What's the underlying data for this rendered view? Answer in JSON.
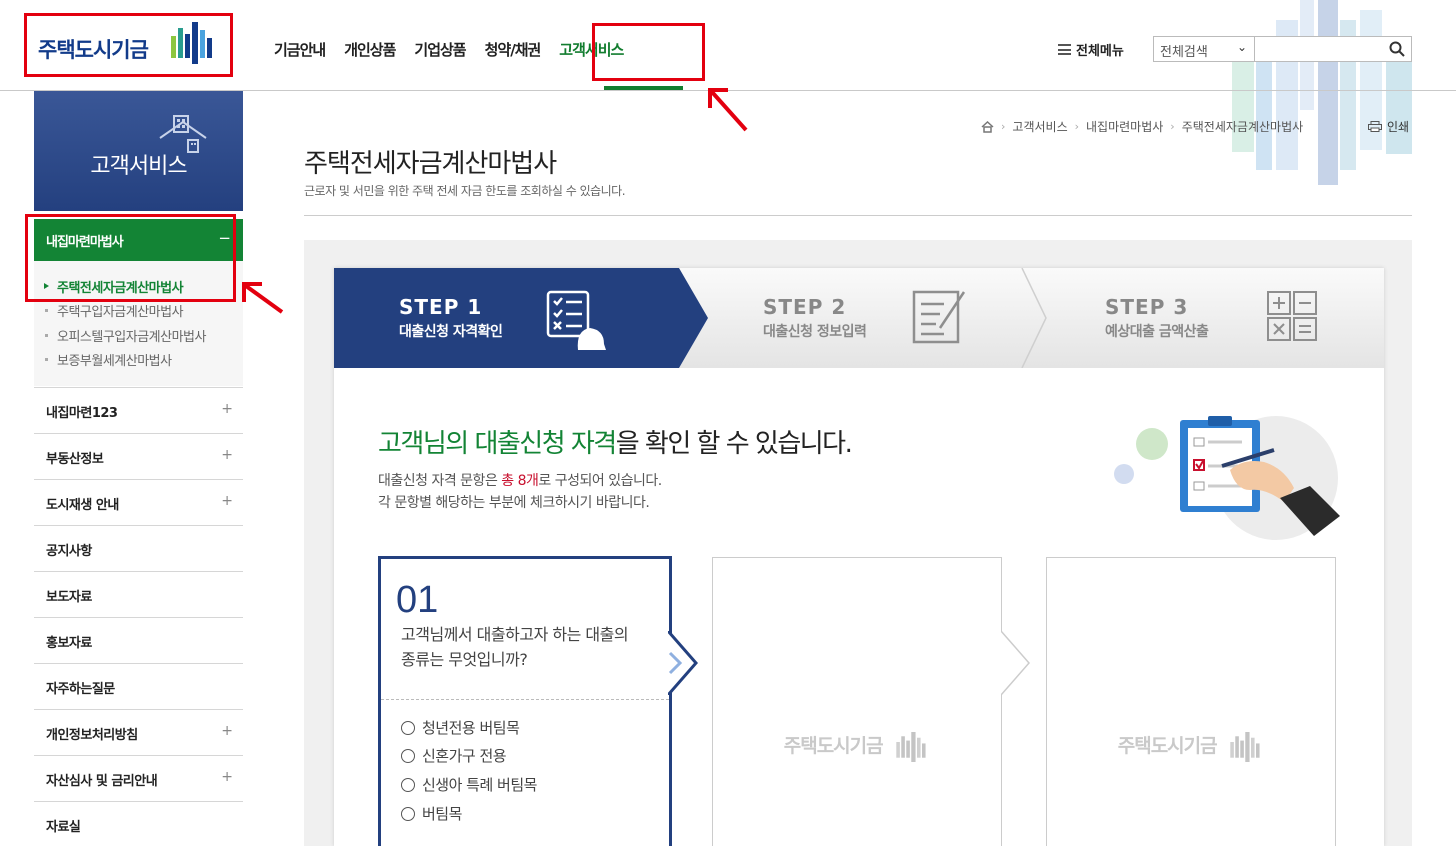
{
  "header": {
    "logo_text": "주택도시기금",
    "nav": [
      "기금안내",
      "개인상품",
      "기업상품",
      "청약/채권",
      "고객서비스"
    ],
    "active_nav": "고객서비스",
    "all_menu_label": "전체메뉴",
    "search_scope": "전체검색",
    "search_placeholder": ""
  },
  "sidebar": {
    "title": "고객서비스",
    "current_section": "내집마련마법사",
    "current_toggle": "−",
    "sub_items": [
      "주택전세자금계산마법사",
      "주택구입자금계산마법사",
      "오피스텔구입자금계산마법사",
      "보증부월세계산마법사"
    ],
    "menu": [
      {
        "label": "내집마련123",
        "toggle": "+"
      },
      {
        "label": "부동산정보",
        "toggle": "+"
      },
      {
        "label": "도시재생 안내",
        "toggle": "+"
      },
      {
        "label": "공지사항",
        "toggle": ""
      },
      {
        "label": "보도자료",
        "toggle": ""
      },
      {
        "label": "홍보자료",
        "toggle": ""
      },
      {
        "label": "자주하는질문",
        "toggle": ""
      },
      {
        "label": "개인정보처리방침",
        "toggle": "+"
      },
      {
        "label": "자산심사 및 금리안내",
        "toggle": "+"
      },
      {
        "label": "자료실",
        "toggle": ""
      }
    ]
  },
  "breadcrumb": [
    "고객서비스",
    "내집마련마법사",
    "주택전세자금계산마법사"
  ],
  "print_label": "인쇄",
  "page": {
    "title": "주택전세자금계산마법사",
    "desc": "근로자 및 서민을 위한 주택 전세 자금 한도를 조회하실 수 있습니다."
  },
  "steps": [
    {
      "step": "STEP 1",
      "label": "대출신청 자격확인"
    },
    {
      "step": "STEP 2",
      "label": "대출신청 정보입력"
    },
    {
      "step": "STEP 3",
      "label": "예상대출 금액산출"
    }
  ],
  "intro": {
    "headline_green": "고객님의 대출신청 자격",
    "headline_rest": "을 확인 할 수 있습니다.",
    "desc1_pre": "대출신청 자격 문항은 ",
    "desc1_red": "총 8개",
    "desc1_post": "로 구성되어 있습니다.",
    "desc2": "각 문항별 해당하는 부분에 체크하시기 바랍니다."
  },
  "question": {
    "number": "01",
    "text": "고객님께서 대출하고자 하는 대출의 종류는 무엇입니까?",
    "options": [
      "청년전용 버팀목",
      "신혼가구 전용",
      "신생아 특례 버팀목",
      "버팀목"
    ]
  },
  "watermark_text": "주택도시기금",
  "colors": {
    "brand_navy": "#23407f",
    "brand_green": "#138435",
    "highlight_red": "#e3000f"
  }
}
